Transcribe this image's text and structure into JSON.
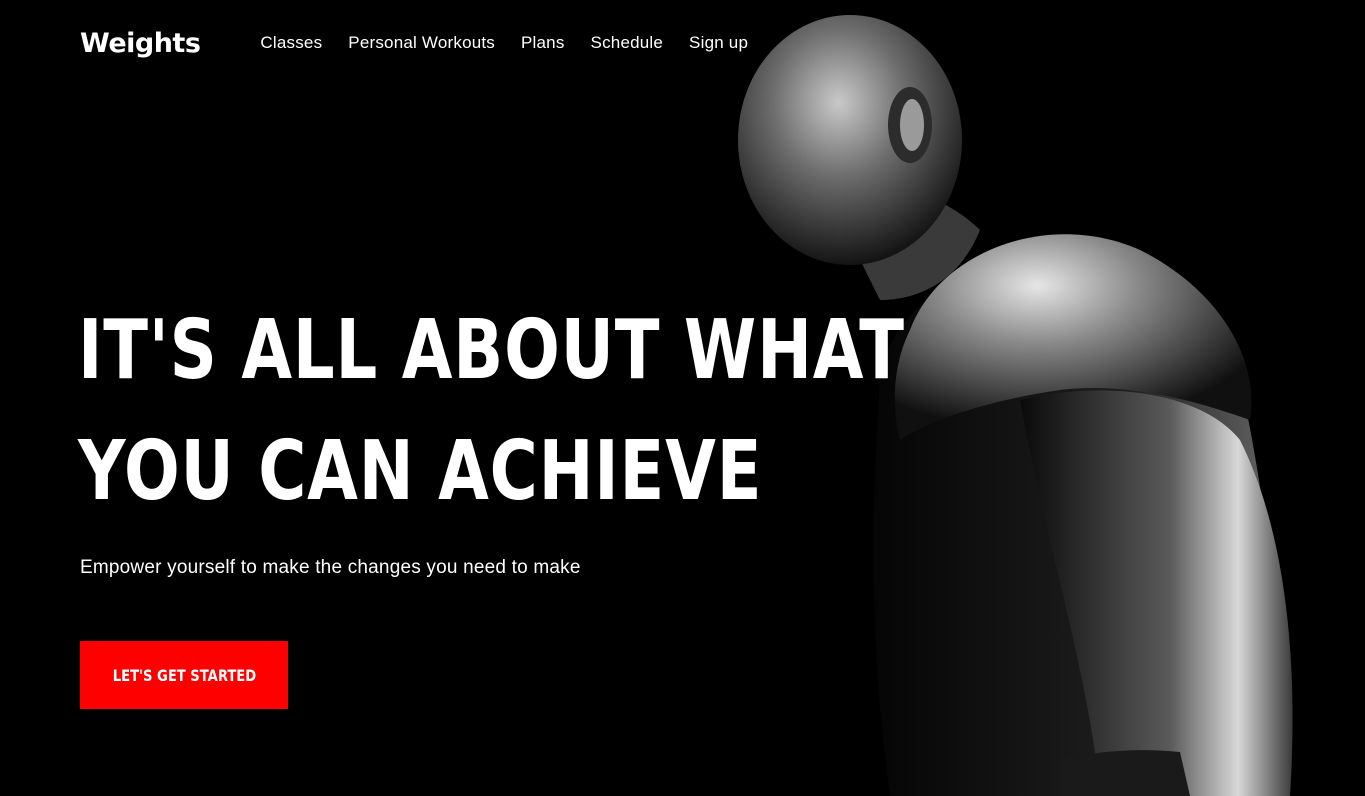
{
  "brand": {
    "logo_text": "Weights"
  },
  "nav": {
    "items": [
      {
        "label": "Classes"
      },
      {
        "label": "Personal Workouts"
      },
      {
        "label": "Plans"
      },
      {
        "label": "Schedule"
      },
      {
        "label": "Sign up"
      }
    ]
  },
  "hero": {
    "headline_line1": "IT'S ALL ABOUT WHAT",
    "headline_line2": "YOU CAN ACHIEVE",
    "subheadline": "Empower yourself to make the changes you need to make",
    "cta_label": "LET'S GET STARTED",
    "image_subject": "muscular-man-black-and-white-photo"
  },
  "colors": {
    "background": "#000000",
    "text": "#ffffff",
    "accent": "#ff0000"
  }
}
